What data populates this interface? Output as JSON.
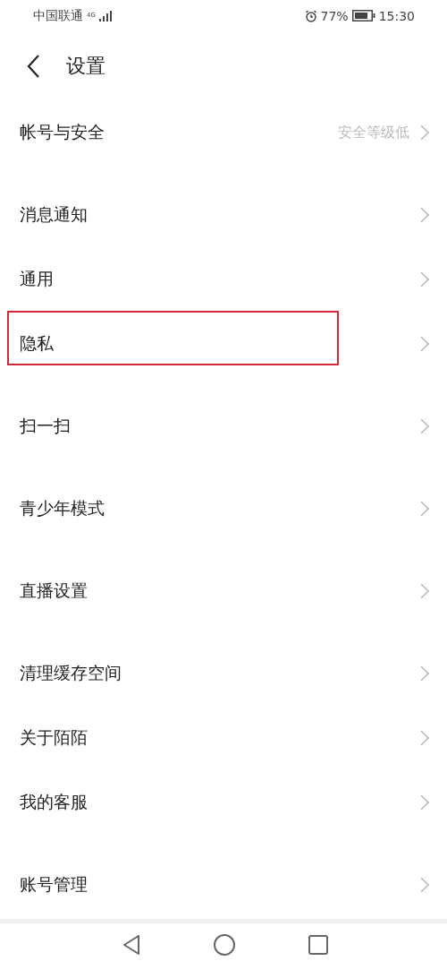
{
  "status_bar": {
    "carrier": "中国联通",
    "network": "4G",
    "battery": "77%",
    "time": "15:30"
  },
  "header": {
    "title": "设置"
  },
  "sections": [
    {
      "items": [
        {
          "label": "帐号与安全",
          "value": "安全等级低",
          "highlighted": false
        }
      ]
    },
    {
      "items": [
        {
          "label": "消息通知",
          "highlighted": false
        },
        {
          "label": "通用",
          "highlighted": false
        },
        {
          "label": "隐私",
          "highlighted": true
        }
      ]
    },
    {
      "items": [
        {
          "label": "扫一扫",
          "highlighted": false
        }
      ]
    },
    {
      "items": [
        {
          "label": "青少年模式",
          "highlighted": false
        }
      ]
    },
    {
      "items": [
        {
          "label": "直播设置",
          "highlighted": false
        }
      ]
    },
    {
      "items": [
        {
          "label": "清理缓存空间",
          "highlighted": false
        },
        {
          "label": "关于陌陌",
          "highlighted": false
        },
        {
          "label": "我的客服",
          "highlighted": false
        }
      ]
    },
    {
      "items": [
        {
          "label": "账号管理",
          "highlighted": false
        }
      ]
    }
  ]
}
